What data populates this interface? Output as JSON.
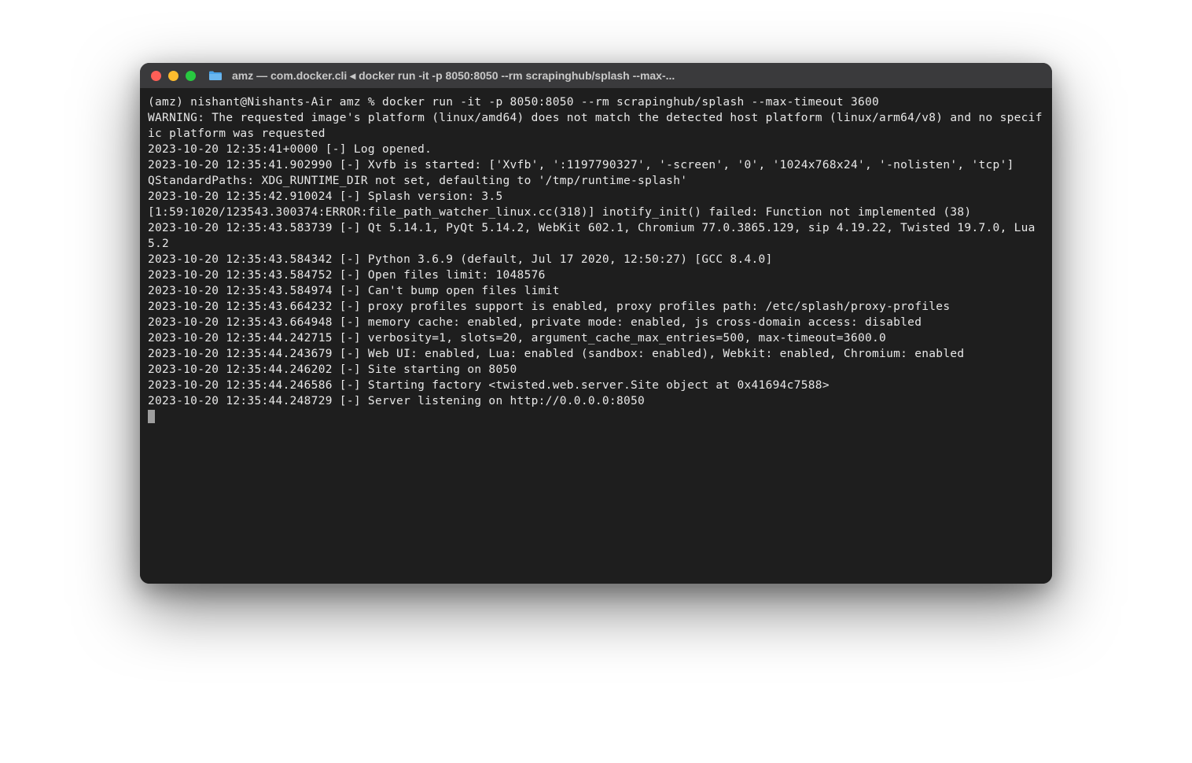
{
  "title_bar": {
    "title": "amz — com.docker.cli ◂ docker run -it -p 8050:8050 --rm scrapinghub/splash --max-..."
  },
  "terminal": {
    "prompt": "(amz) nishant@Nishants-Air amz % ",
    "command": "docker run -it -p 8050:8050 --rm scrapinghub/splash --max-timeout 3600",
    "lines": [
      "WARNING: The requested image's platform (linux/amd64) does not match the detected host platform (linux/arm64/v8) and no specific platform was requested",
      "2023-10-20 12:35:41+0000 [-] Log opened.",
      "2023-10-20 12:35:41.902990 [-] Xvfb is started: ['Xvfb', ':1197790327', '-screen', '0', '1024x768x24', '-nolisten', 'tcp']",
      "QStandardPaths: XDG_RUNTIME_DIR not set, defaulting to '/tmp/runtime-splash'",
      "2023-10-20 12:35:42.910024 [-] Splash version: 3.5",
      "[1:59:1020/123543.300374:ERROR:file_path_watcher_linux.cc(318)] inotify_init() failed: Function not implemented (38)",
      "2023-10-20 12:35:43.583739 [-] Qt 5.14.1, PyQt 5.14.2, WebKit 602.1, Chromium 77.0.3865.129, sip 4.19.22, Twisted 19.7.0, Lua 5.2",
      "2023-10-20 12:35:43.584342 [-] Python 3.6.9 (default, Jul 17 2020, 12:50:27) [GCC 8.4.0]",
      "2023-10-20 12:35:43.584752 [-] Open files limit: 1048576",
      "2023-10-20 12:35:43.584974 [-] Can't bump open files limit",
      "2023-10-20 12:35:43.664232 [-] proxy profiles support is enabled, proxy profiles path: /etc/splash/proxy-profiles",
      "2023-10-20 12:35:43.664948 [-] memory cache: enabled, private mode: enabled, js cross-domain access: disabled",
      "2023-10-20 12:35:44.242715 [-] verbosity=1, slots=20, argument_cache_max_entries=500, max-timeout=3600.0",
      "2023-10-20 12:35:44.243679 [-] Web UI: enabled, Lua: enabled (sandbox: enabled), Webkit: enabled, Chromium: enabled",
      "2023-10-20 12:35:44.246202 [-] Site starting on 8050",
      "2023-10-20 12:35:44.246586 [-] Starting factory <twisted.web.server.Site object at 0x41694c7588>",
      "2023-10-20 12:35:44.248729 [-] Server listening on http://0.0.0.0:8050"
    ]
  }
}
